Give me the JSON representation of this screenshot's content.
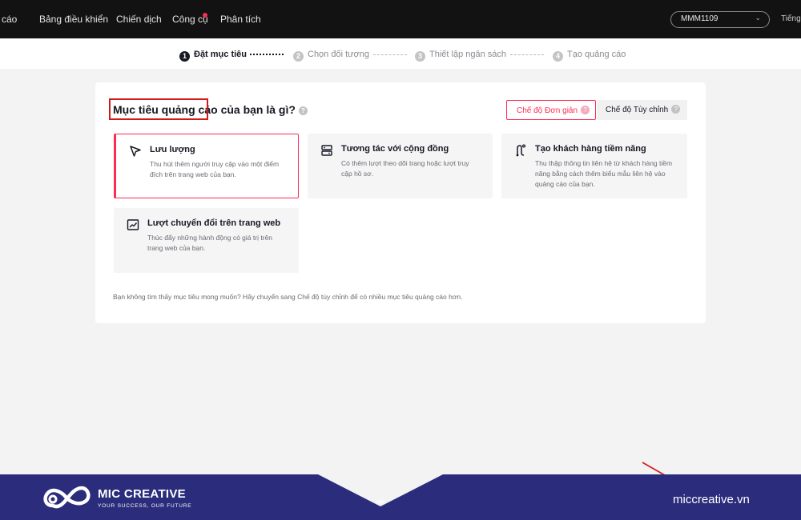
{
  "topnav": {
    "left_cut": "cáo",
    "items": [
      "Bảng điều khiển",
      "Chiến dịch",
      "Công cụ",
      "Phân tích"
    ],
    "account": "MMM1109",
    "language": "Tiếng Việt"
  },
  "steps": [
    {
      "num": "1",
      "label": "Đặt mục tiêu"
    },
    {
      "num": "2",
      "label": "Chọn đối tượng"
    },
    {
      "num": "3",
      "label": "Thiết lập ngân sách"
    },
    {
      "num": "4",
      "label": "Tạo quảng cáo"
    }
  ],
  "card": {
    "question": "Mục tiêu quảng cáo của bạn là gì?",
    "mode_simple": "Chế độ Đơn giản",
    "mode_custom": "Chế độ Tùy chỉnh",
    "objectives": [
      {
        "title": "Lưu lượng",
        "desc": "Thu hút thêm người truy cập vào một điểm đích trên trang web của bạn.",
        "icon": "cursor-arrow-icon"
      },
      {
        "title": "Tương tác với cộng đồng",
        "desc": "Có thêm lượt theo dõi trang hoặc lượt truy cập hồ sơ.",
        "icon": "community-icon"
      },
      {
        "title": "Tạo khách hàng tiềm năng",
        "desc": "Thu thập thông tin liên hệ từ khách hàng tiềm năng bằng cách thêm biểu mẫu liên hệ vào quảng cáo của bạn.",
        "icon": "lead-path-icon"
      },
      {
        "title": "Lượt chuyển đổi trên trang web",
        "desc": "Thúc đẩy những hành động có giá trị trên trang web của bạn.",
        "icon": "trend-chart-icon"
      }
    ],
    "footnote": "Bạn không tìm thấy mục tiêu mong muốn? Hãy chuyển sang Chế độ tùy chỉnh để có nhiều mục tiêu quảng cáo hơn."
  },
  "brand": {
    "name": "MIC CREATIVE",
    "tagline": "YOUR SUCCESS, OUR FUTURE",
    "url": "miccreative.vn"
  },
  "colors": {
    "accent": "#fe2c55",
    "annotation": "#d01a1a",
    "banner": "#2b2d7c",
    "topbar": "#121212"
  }
}
